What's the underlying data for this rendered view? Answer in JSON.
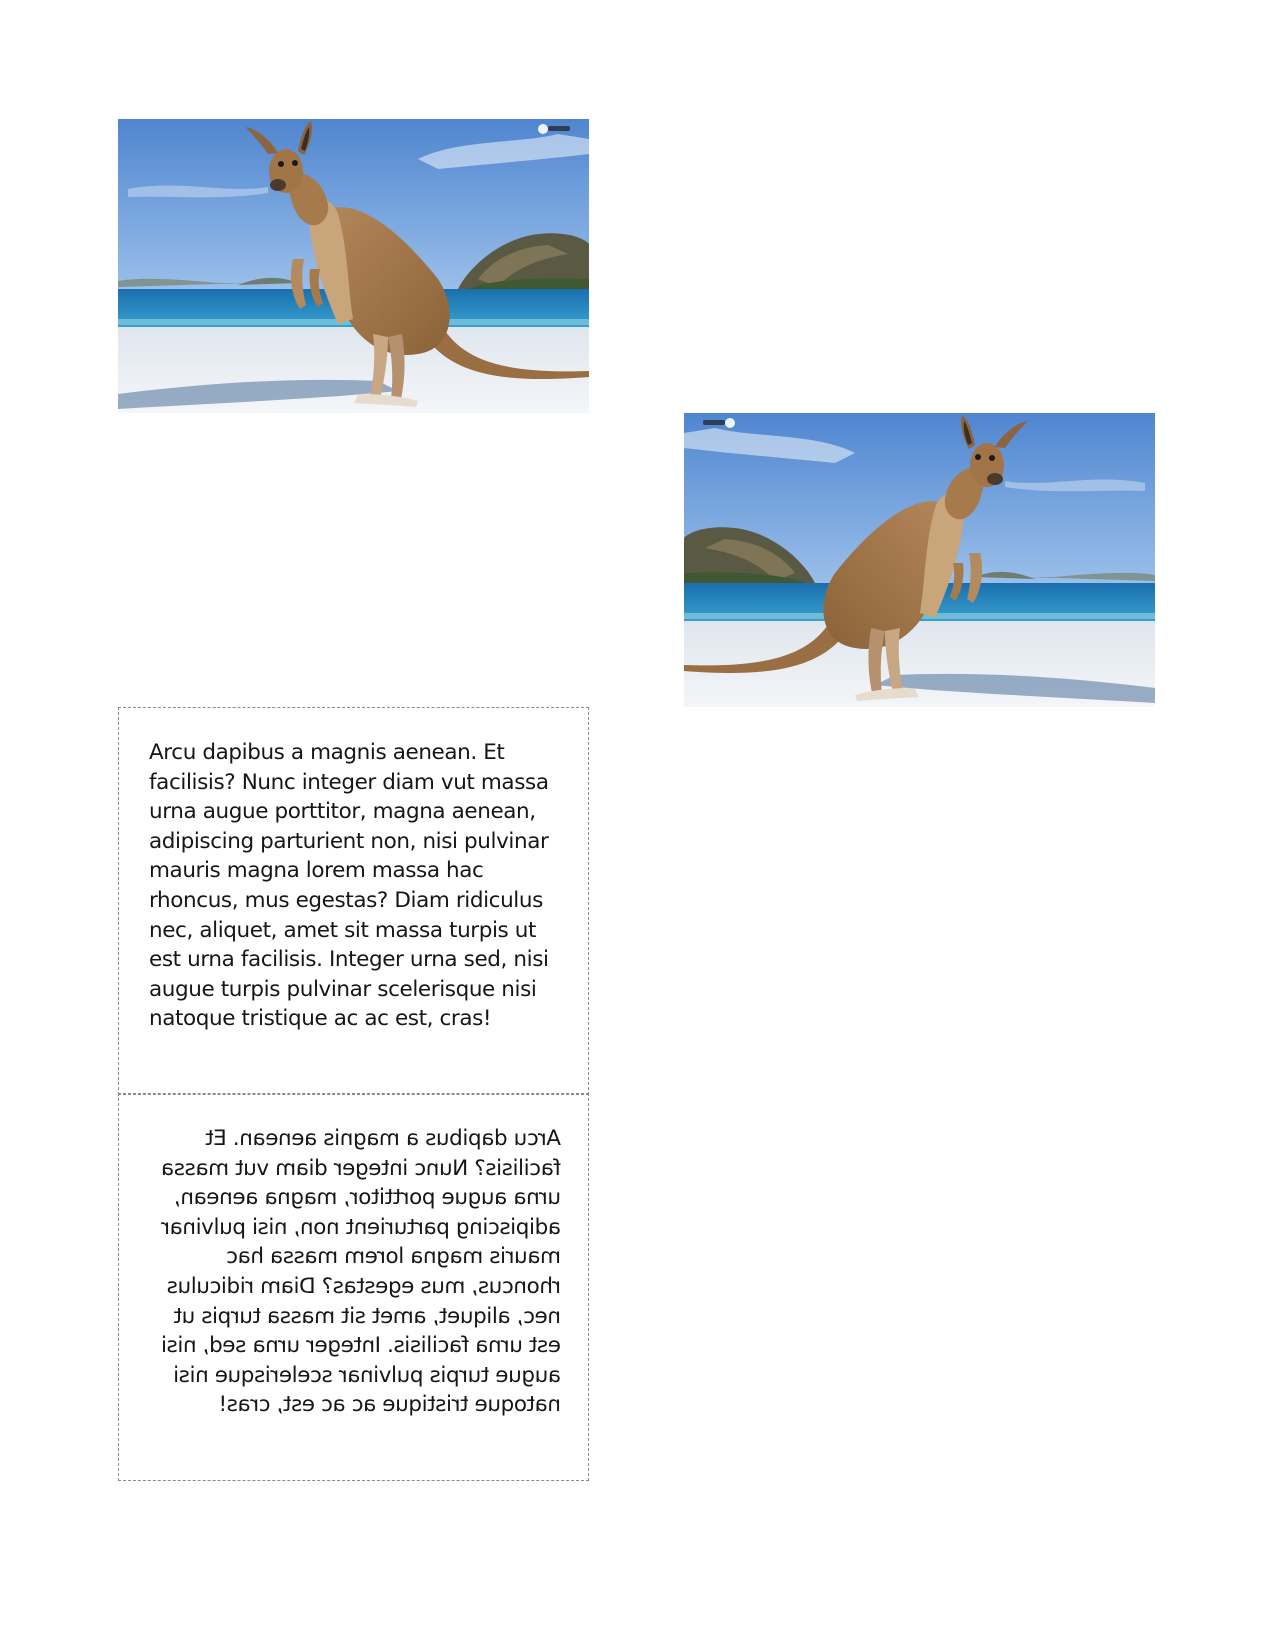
{
  "document": {
    "images": [
      {
        "subject": "kangaroo-on-beach",
        "orientation": "original"
      },
      {
        "subject": "kangaroo-on-beach",
        "orientation": "mirrored-horizontally"
      }
    ],
    "paragraph_normal": "Arcu dapibus a magnis aenean. Et facilisis? Nunc integer diam vut massa urna augue porttitor, magna aenean, adipiscing parturient non, nisi pulvinar mauris magna lorem massa hac rhoncus, mus egestas? Diam ridiculus nec, aliquet, amet sit massa turpis ut est urna facilisis. Integer urna sed, nisi augue turpis pulvinar scelerisque nisi natoque tristique ac ac est, cras!",
    "paragraph_mirrored": "Arcu dapibus a magnis aenean. Et facilisis? Nunc integer diam vut massa urna augue porttitor, magna aenean, adipiscing parturient non, nisi pulvinar mauris magna lorem massa hac rhoncus, mus egestas? Diam ridiculus nec, aliquet, amet sit massa turpis ut est urna facilisis. Integer urna sed, nisi augue turpis pulvinar scelerisque nisi natoque tristique ac ac est, cras!",
    "colors": {
      "sky": "#5b8fd4",
      "sea": "#1f7fb8",
      "sand": "#eef1f4",
      "kangaroo": "#a77a4c",
      "border": "#8a8a8a",
      "text": "#161616"
    }
  }
}
